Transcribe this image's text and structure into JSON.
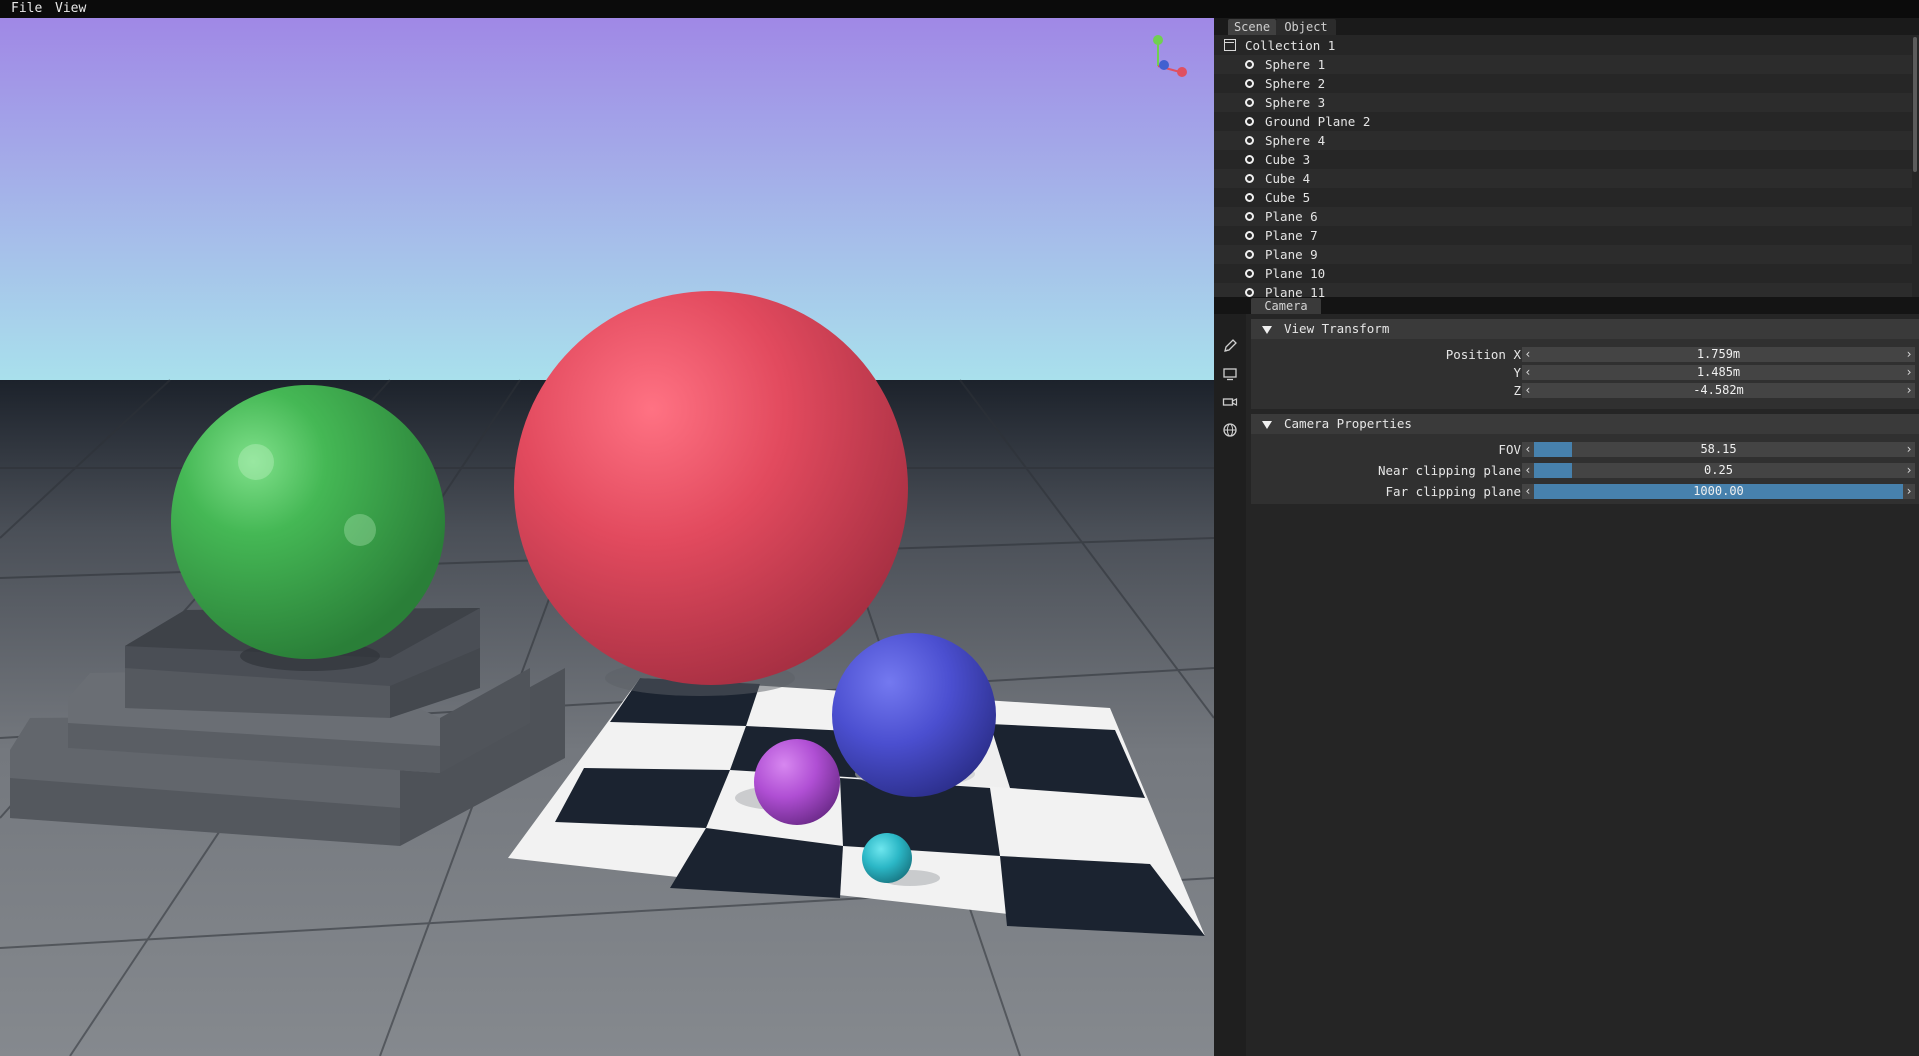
{
  "menu": {
    "file": "File",
    "view": "View"
  },
  "scene_panel": {
    "tabs": [
      "Scene",
      "Object"
    ],
    "collection": "Collection 1",
    "objects": [
      "Sphere 1",
      "Sphere 2",
      "Sphere 3",
      "Ground Plane 2",
      "Sphere 4",
      "Cube 3",
      "Cube 4",
      "Cube 5",
      "Plane 6",
      "Plane 7",
      "Plane 9",
      "Plane 10",
      "Plane 11"
    ]
  },
  "camera_panel": {
    "tab": "Camera",
    "icons": [
      "pencil-icon",
      "monitor-icon",
      "camera-icon",
      "globe-icon"
    ],
    "view_transform": {
      "title": "View Transform",
      "position_label": "Position X",
      "y_label": "Y",
      "z_label": "Z",
      "x": "1.759m",
      "y": "1.485m",
      "z": "-4.582m"
    },
    "camera_properties": {
      "title": "Camera Properties",
      "fov_label": "FOV",
      "fov": "58.15",
      "fov_fill": 0.104,
      "near_label": "Near clipping plane",
      "near": "0.25",
      "near_fill": 0.104,
      "far_label": "Far clipping plane",
      "far": "1000.00",
      "far_fill": 1.0
    }
  },
  "viewport": {
    "sky_top": "#a088e6",
    "sky_bottom": "#a9e0ec",
    "horizon": "#1e2530",
    "floor": "#7a7e84",
    "objects": [
      {
        "name": "green-sphere",
        "color": "#3fae4e"
      },
      {
        "name": "red-sphere",
        "color": "#e44a5e"
      },
      {
        "name": "blue-sphere",
        "color": "#4b4fd0"
      },
      {
        "name": "purple-sphere",
        "color": "#b34fd6"
      },
      {
        "name": "cyan-sphere",
        "color": "#2bb7c6"
      }
    ],
    "gizmo": {
      "x_color": "#e05060",
      "y_color": "#70d050",
      "z_color": "#4060d0"
    }
  }
}
